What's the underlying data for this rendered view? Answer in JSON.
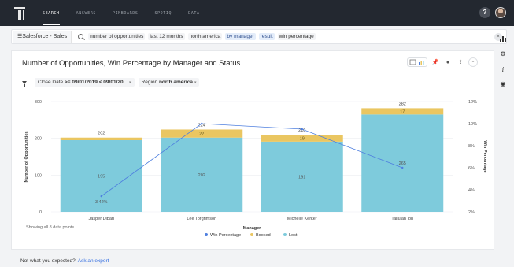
{
  "nav": {
    "items": [
      "SEARCH",
      "ANSWERS",
      "PINBOARDS",
      "SPOTIQ",
      "DATA"
    ],
    "help": "?"
  },
  "search": {
    "source": "Salesforce - Sales",
    "tokens": [
      {
        "text": "number of opportunities",
        "style": "plain"
      },
      {
        "text": "last 12 months",
        "style": "plain"
      },
      {
        "text": "north america",
        "style": "plain"
      },
      {
        "text": "by manager",
        "style": "blue"
      },
      {
        "text": "result",
        "style": "blue"
      },
      {
        "text": "win percentage",
        "style": "plain"
      }
    ],
    "clear": "×"
  },
  "panel": {
    "title": "Number of Opportunities, Win Percentage by Manager and Status",
    "filters": {
      "date_label": "Close Date ",
      "date_value": ">= 09/01/2019 < 09/01/20...",
      "region_label": "Region ",
      "region_value": "north america"
    },
    "showing": "Showing all 8 data points"
  },
  "footer": {
    "question": "Not what you expected?",
    "link": "Ask an expert"
  },
  "chart_data": {
    "type": "bar",
    "stacked": true,
    "categories": [
      "Jasper Dibari",
      "Lee Torgrimson",
      "Michelle Kerker",
      "Tallulah Ion"
    ],
    "series": [
      {
        "name": "Lost",
        "values": [
          195,
          202,
          191,
          265
        ],
        "color": "#7ecbdc"
      },
      {
        "name": "Booked",
        "values": [
          7,
          22,
          19,
          17
        ],
        "color": "#eac661"
      },
      {
        "name": "Win Percentage",
        "values": [
          3.42,
          10.0,
          9.5,
          6.0
        ],
        "color": "#4e7fdf",
        "axis": "right"
      }
    ],
    "totals": [
      202,
      224,
      210,
      282
    ],
    "data_labels": {
      "lost": [
        "195",
        "202",
        "191",
        "265"
      ],
      "booked": [
        "",
        "22",
        "19",
        "17"
      ],
      "totals": [
        "202",
        "224",
        "210",
        "282"
      ],
      "win": "3.42%"
    },
    "xlabel": "Manager",
    "ylabel": "Number of Opportunities",
    "y2label": "Win Percentage",
    "ylim": [
      0,
      300
    ],
    "yticks": [
      "0",
      "100",
      "200",
      "300"
    ],
    "y2lim": [
      2,
      12
    ],
    "y2ticks": [
      "2%",
      "4%",
      "6%",
      "8%",
      "10%",
      "12%"
    ],
    "legend": [
      "Win Percentage",
      "Booked",
      "Lost"
    ],
    "legend_position": "bottom"
  }
}
